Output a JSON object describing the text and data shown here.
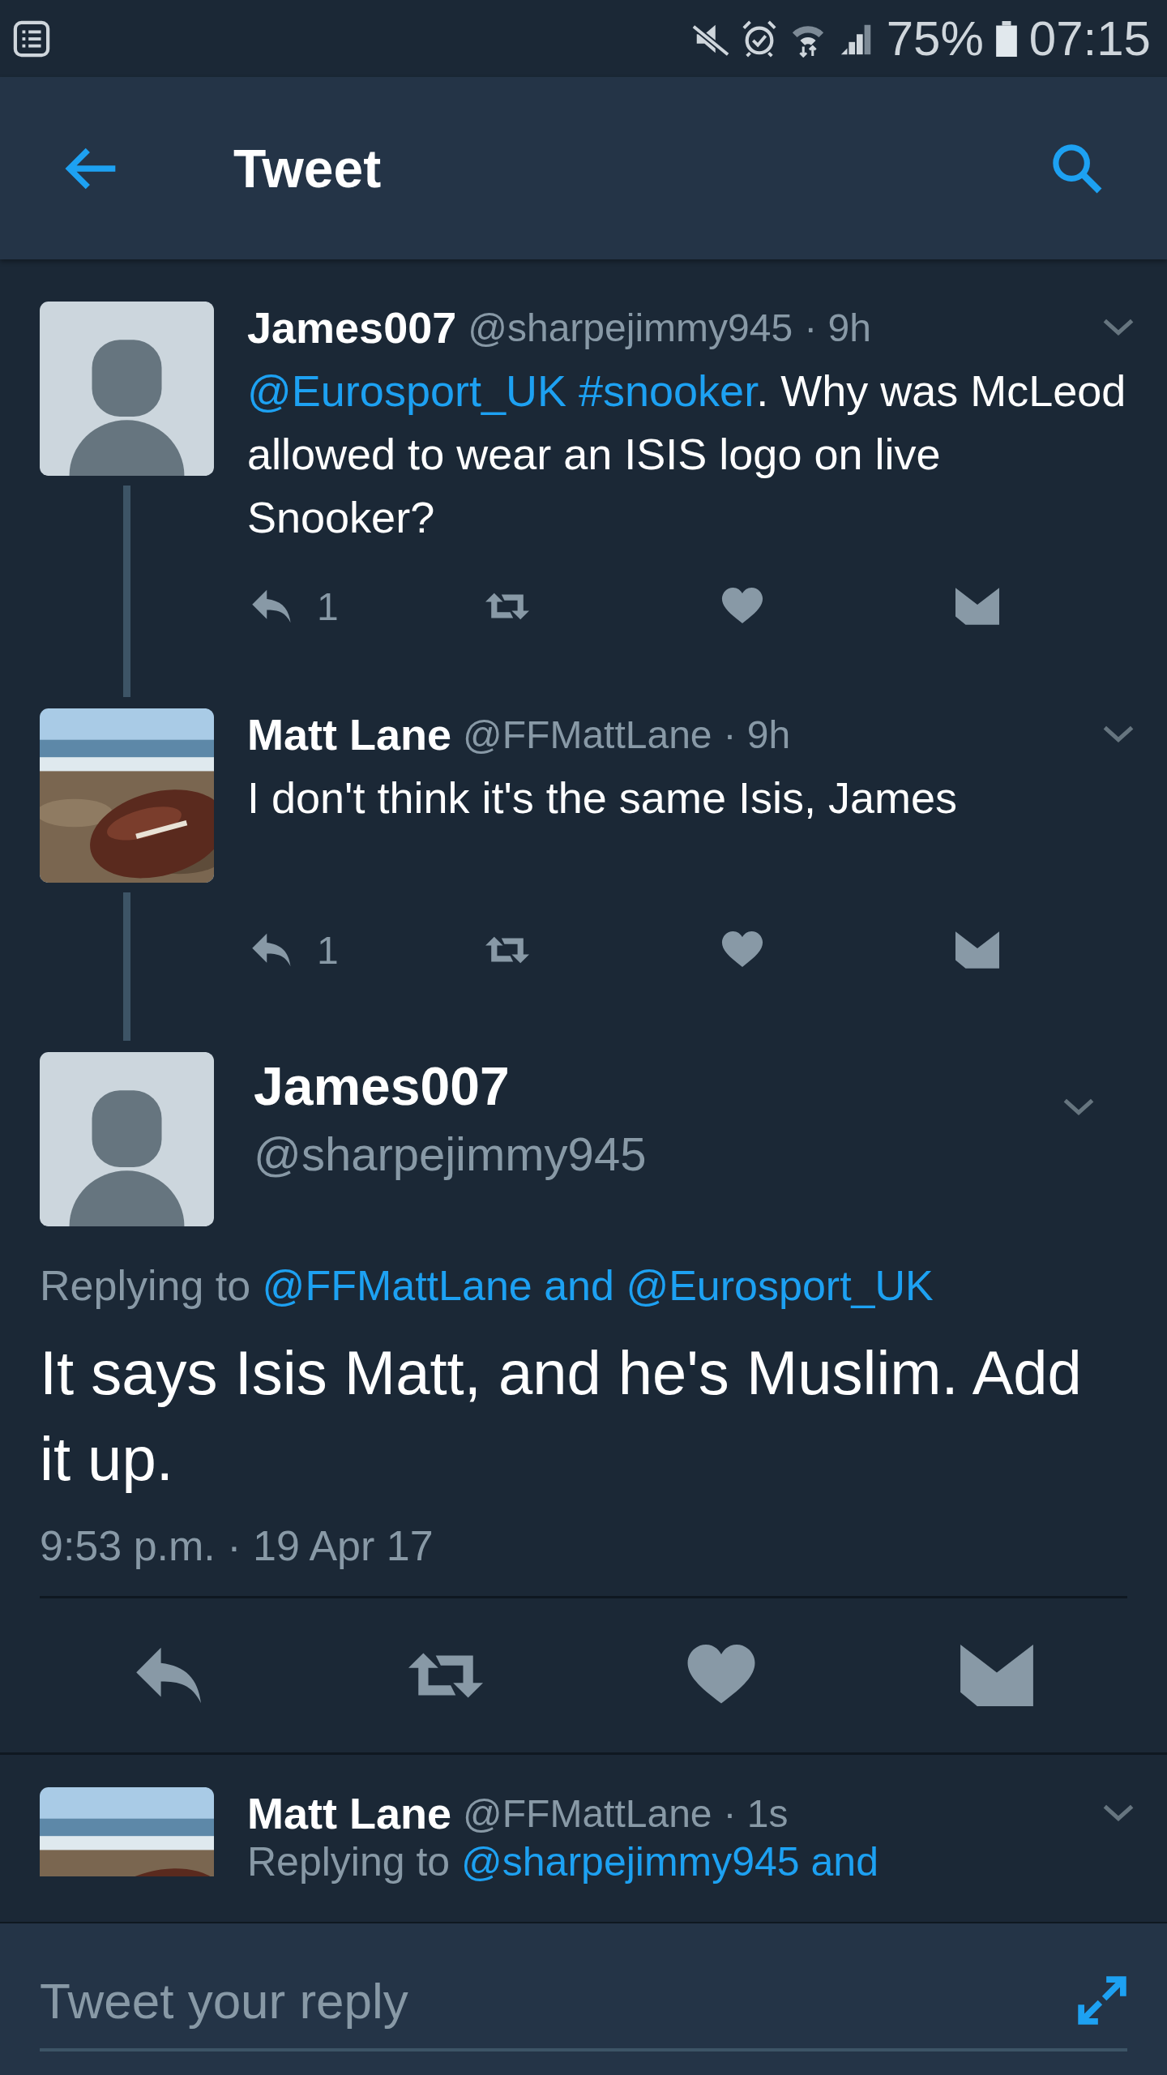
{
  "status_bar": {
    "battery": "75%",
    "time": "07:15"
  },
  "header": {
    "title": "Tweet"
  },
  "thread": [
    {
      "name": "James007",
      "handle": "@sharpejimmy945",
      "time": "· 9h",
      "photo": false,
      "connected": true,
      "text": [
        {
          "kind": "link",
          "text": "@Eurosport_UK #snooker"
        },
        {
          "kind": "plain",
          "text": ". Why was McLeod allowed to wear an ISIS logo on live Snooker?"
        }
      ],
      "replies": "1"
    },
    {
      "name": "Matt Lane",
      "handle": "@FFMattLane",
      "time": "· 9h",
      "photo": true,
      "connected": true,
      "text": [
        {
          "kind": "plain",
          "text": "I don't think it's the same Isis, James"
        }
      ],
      "replies": "1"
    }
  ],
  "focused": {
    "name": "James007",
    "handle": "@sharpejimmy945",
    "photo": false,
    "replying_to": [
      {
        "kind": "plain",
        "text": "Replying to "
      },
      {
        "kind": "link",
        "text": "@FFMattLane and @Eurosport_UK"
      }
    ],
    "text": "It says Isis Matt, and he's Muslim. Add it up.",
    "timestamp": "9:53 p.m. · 19 Apr 17"
  },
  "next": {
    "name": "Matt Lane",
    "handle": "@FFMattLane",
    "time": "· 1s",
    "photo": true,
    "replying_to": [
      {
        "kind": "plain",
        "text": "Replying to "
      },
      {
        "kind": "link",
        "text": "@sharpejimmy945 and"
      }
    ]
  },
  "reply_bar": {
    "placeholder": "Tweet your reply"
  }
}
